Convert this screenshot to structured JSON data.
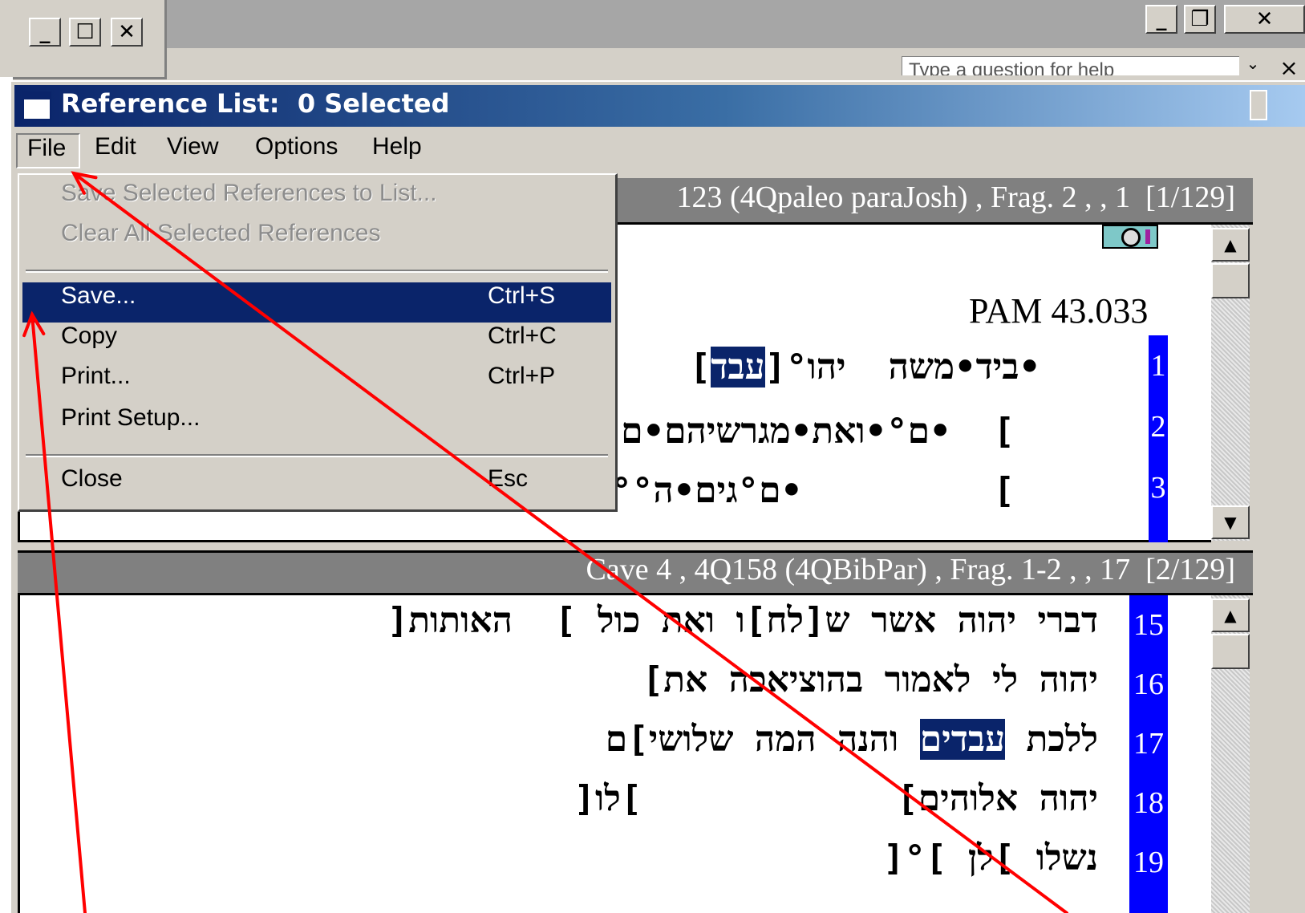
{
  "help": {
    "placeholder": "Type a question for help",
    "drop_glyph": "⌄",
    "close_glyph": "×"
  },
  "outer_controls": {
    "minimize": "_",
    "maximize": "☐",
    "close": "✕",
    "restore": "❐"
  },
  "window": {
    "title": "Reference List:  0 Selected",
    "menu": [
      "File",
      "Edit",
      "View",
      "Options",
      "Help"
    ]
  },
  "file_menu": {
    "items": [
      {
        "label": "Save Selected References to List...",
        "shortcut": "",
        "disabled": true
      },
      {
        "label": "Clear All Selected References",
        "shortcut": "",
        "disabled": true
      },
      {
        "label": "Save...",
        "shortcut": "Ctrl+S",
        "selected": true
      },
      {
        "label": "Copy",
        "shortcut": "Ctrl+C"
      },
      {
        "label": "Print...",
        "shortcut": "Ctrl+P"
      },
      {
        "label": "Print Setup...",
        "shortcut": ""
      },
      {
        "label": "Close",
        "shortcut": "Esc"
      }
    ]
  },
  "pane1": {
    "header": "123 (4Qpaleo paraJosh) , Frag. 2 , , 1  [1/129]",
    "pam": "PAM 43.033",
    "lines": [
      {
        "num": "1",
        "before": "]",
        "highlight": "עבד",
        "after": "•ביד•משה  יהו°["
      },
      {
        "num": "2",
        "text": "]  •ם°•ואת•מגרשיהם•ם°["
      },
      {
        "num": "3",
        "text": "]         •ם°גים•ה°°טה["
      }
    ]
  },
  "pane2": {
    "header": "Cave 4 , 4Q158 (4QBibPar) , Frag. 1-2 , , 17  [2/129]",
    "lines": [
      {
        "num": "15",
        "text": "דברי יהוה אשר ש[לח]ו ואת כול ]  האותות["
      },
      {
        "num": "16",
        "text": "יהוה לי לאמור בהוציאכה את]"
      },
      {
        "num": "17",
        "before": "ללכת ",
        "highlight": "עבדים",
        "after": " והנה המה שלושי]ם"
      },
      {
        "num": "18",
        "text": "יהוה אלוהים]            ]לו["
      },
      {
        "num": "19",
        "text": "נשלו ]לן ]°["
      }
    ]
  },
  "scroll": {
    "up": "▲",
    "down": "▼"
  },
  "colors": {
    "annotation": "#ff0000",
    "highlight": "#0a246a",
    "line_number_bg": "#0000ff"
  }
}
